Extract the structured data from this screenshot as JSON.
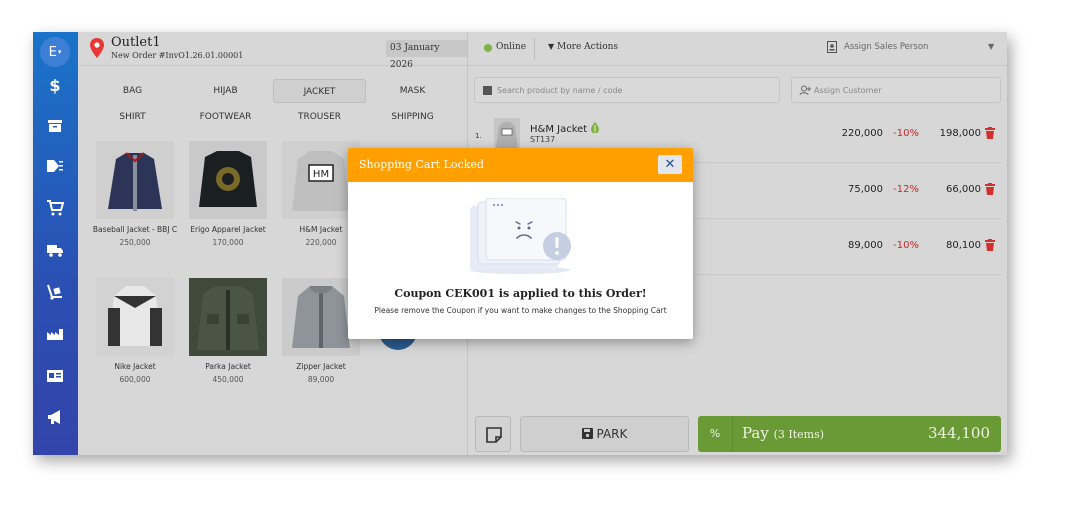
{
  "header": {
    "avatar_letter": "E",
    "outlet_name": "Outlet1",
    "order_number": "New Order #InvO1.26.01.00001",
    "date": "03 January 2026",
    "online_label": "Online",
    "more_actions_label": "More Actions",
    "assign_sales_label": "Assign Sales Person"
  },
  "sidebar": {
    "items": [
      {
        "icon": "dollar-icon"
      },
      {
        "icon": "inbox-icon"
      },
      {
        "icon": "tags-icon"
      },
      {
        "icon": "cart-icon"
      },
      {
        "icon": "truck-icon"
      },
      {
        "icon": "dolly-icon"
      },
      {
        "icon": "warehouse-icon"
      },
      {
        "icon": "id-card-icon"
      },
      {
        "icon": "megaphone-icon"
      }
    ]
  },
  "categories": [
    {
      "label": "BAG",
      "active": false
    },
    {
      "label": "HIJAB",
      "active": false
    },
    {
      "label": "JACKET",
      "active": true
    },
    {
      "label": "MASK",
      "active": false
    },
    {
      "label": "SHIRT",
      "active": false
    },
    {
      "label": "FOOTWEAR",
      "active": false
    },
    {
      "label": "TROUSER",
      "active": false
    },
    {
      "label": "SHIPPING",
      "active": false
    }
  ],
  "products": [
    {
      "name": "Baseball Jacket - BBJ C",
      "price": "250,000"
    },
    {
      "name": "Erigo Apparel Jacket",
      "price": "170,000"
    },
    {
      "name": "H&M Jacket",
      "price": "220,000"
    },
    {
      "name": "Nike Jacket",
      "price": "600,000"
    },
    {
      "name": "Parka Jacket",
      "price": "450,000"
    },
    {
      "name": "Zipper Jacket",
      "price": "89,000"
    }
  ],
  "search": {
    "placeholder": "Search product by name / code"
  },
  "customer": {
    "placeholder": "Assign Customer"
  },
  "cart": {
    "items": [
      {
        "index": "1.",
        "name": "H&M Jacket",
        "sku": "ST137",
        "price": "220,000",
        "discount": "-10%",
        "net": "198,000"
      },
      {
        "index": "",
        "name": "",
        "sku": "",
        "price": "75,000",
        "discount": "-12%",
        "net": "66,000"
      },
      {
        "index": "",
        "name": "",
        "sku": "",
        "price": "89,000",
        "discount": "-10%",
        "net": "80,100"
      }
    ]
  },
  "footer": {
    "park_label": "PARK",
    "pay_label": "Pay",
    "pay_count": "(3 Items)",
    "pay_total": "344,100",
    "percent_label": "%"
  },
  "modal": {
    "title": "Shopping Cart Locked",
    "close_glyph": "✕",
    "message": "Coupon CEK001 is applied to this Order!",
    "sub_message": "Please remove the Coupon if you want to make changes to the Shopping Cart"
  },
  "colors": {
    "sidebar_top": "#1a73c9",
    "modal_header": "#ffa000",
    "pay_button": "#6a9a35",
    "discount": "#c62828",
    "trash": "#d32f2f",
    "online": "#7cb342"
  }
}
